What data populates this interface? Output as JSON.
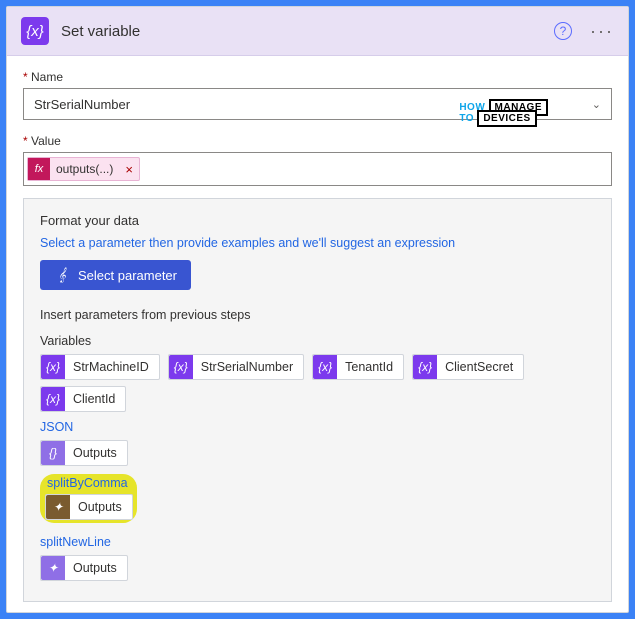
{
  "header": {
    "title": "Set variable"
  },
  "fields": {
    "nameLabel": "Name",
    "nameValue": "StrSerialNumber",
    "valueLabel": "Value",
    "valueToken": "outputs(...)"
  },
  "panel": {
    "title": "Format your data",
    "hint": "Select a parameter then provide examples and we'll suggest an expression",
    "selectParam": "Select parameter",
    "insertTitle": "Insert parameters from previous steps"
  },
  "groups": {
    "variables": {
      "label": "Variables",
      "items": [
        "StrMachineID",
        "StrSerialNumber",
        "TenantId",
        "ClientSecret",
        "ClientId"
      ]
    },
    "json": {
      "label": "JSON",
      "item": "Outputs"
    },
    "splitByComma": {
      "label": "splitByComma",
      "item": "Outputs"
    },
    "splitNewLine": {
      "label": "splitNewLine",
      "item": "Outputs"
    }
  },
  "watermark": {
    "how": "HOW",
    "to": "TO",
    "line1": "MANAGE",
    "line2": "DEVICES"
  }
}
